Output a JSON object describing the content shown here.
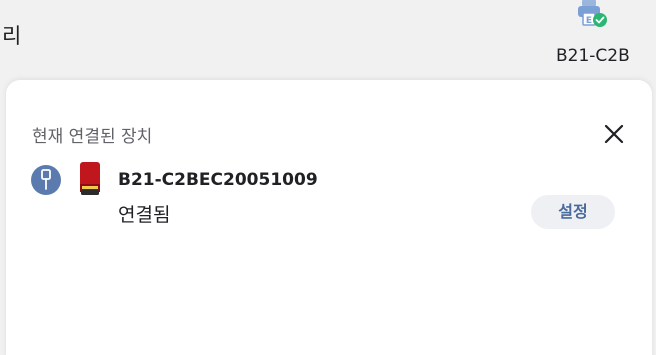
{
  "background": {
    "left_text": "리",
    "printer": {
      "icon": "printer-check-icon",
      "label": "B21-C2B"
    }
  },
  "panel": {
    "title": "현재 연결된 장치",
    "close_icon": "close-icon",
    "device": {
      "connection_icon": "usb-icon",
      "device_icon": "red-book-icon",
      "name": "B21-C2BEC20051009",
      "status": "연결됨",
      "settings_label": "설정"
    }
  },
  "colors": {
    "accent": "#4a6a9c",
    "usb_circle": "#5b7bae",
    "book_red": "#c0161e",
    "check_green": "#2bb673",
    "printer_blue": "#7aa0d6"
  }
}
